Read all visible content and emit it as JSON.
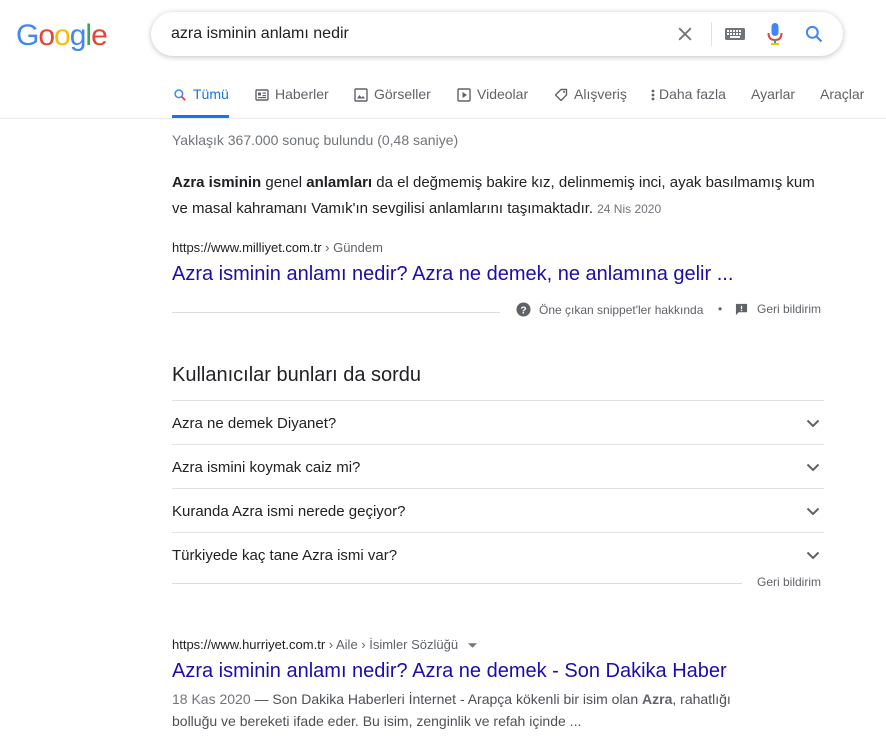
{
  "logo": {
    "letters": [
      "G",
      "o",
      "o",
      "g",
      "l",
      "e"
    ],
    "colors": [
      "#4285f4",
      "#ea4335",
      "#fbbc05",
      "#4285f4",
      "#34a853",
      "#ea4335"
    ]
  },
  "search": {
    "query": "azra isminin anlamı nedir"
  },
  "tabs": [
    {
      "label": "Tümü",
      "icon": "search-icon",
      "active": true
    },
    {
      "label": "Haberler",
      "icon": "news-icon"
    },
    {
      "label": "Görseller",
      "icon": "image-icon"
    },
    {
      "label": "Videolar",
      "icon": "video-icon"
    },
    {
      "label": "Alışveriş",
      "icon": "tag-icon"
    },
    {
      "label": "Daha fazla",
      "icon": "more-vert-icon"
    },
    {
      "label": "Ayarlar"
    },
    {
      "label": "Araçlar"
    }
  ],
  "stats": "Yaklaşık 367.000 sonuç bulundu (0,48 saniye)",
  "featured_snippet": {
    "bold1": "Azra isminin",
    "text1": " genel ",
    "bold2": "anlamları",
    "text2": " da el değmemiş bakire kız, delinmemiş inci, ayak basılmamış kum ve masal kahramanı Vamık'ın sevgilisi anlamlarını taşımaktadır.",
    "date": "24 Nis 2020",
    "url": "https://www.milliyet.com.tr",
    "breadcrumb": " › Gündem",
    "title": "Azra isminin anlamı nedir? Azra ne demek, ne anlamına gelir ...",
    "about_label": "Öne çıkan snippet'ler hakkında",
    "separator": "•",
    "feedback_label": "Geri bildirim"
  },
  "paa": {
    "title": "Kullanıcılar bunları da sordu",
    "questions": [
      "Azra ne demek Diyanet?",
      "Azra ismini koymak caiz mi?",
      "Kuranda Azra ismi nerede geçiyor?",
      "Türkiyede kaç tane Azra ismi var?"
    ],
    "feedback_label": "Geri bildirim"
  },
  "result2": {
    "url": "https://www.hurriyet.com.tr",
    "breadcrumb": " › Aile › İsimler Sözlüğü",
    "title": "Azra isminin anlamı nedir? Azra ne demek - Son Dakika Haber",
    "date": "18 Kas 2020",
    "text_pre": " — Son Dakika Haberleri İnternet - Arapça kökenli bir isim olan ",
    "bold": "Azra",
    "text_post": ", rahatlığı bolluğu ve bereketi ifade eder. Bu isim, zenginlik ve refah içinde ..."
  }
}
